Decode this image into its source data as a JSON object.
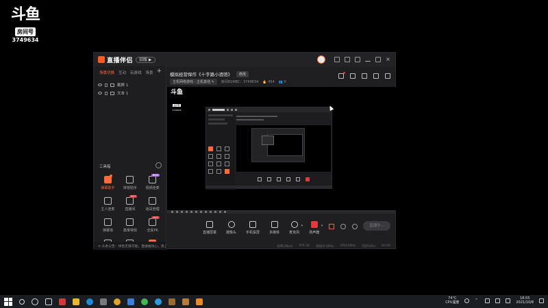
{
  "watermark": {
    "logo": "斗鱼",
    "room_label": "房间号",
    "room_number": "3749634"
  },
  "app": {
    "name": "直播伴侣",
    "version_pill": "旧版 ▶",
    "left": {
      "scene_tabs": [
        "场景切换",
        "互动",
        "玩游戏",
        "场景"
      ],
      "sources": [
        {
          "label": "截屏 1"
        },
        {
          "label": "文本 1"
        }
      ],
      "tools_heading": "工具箱",
      "tools": [
        {
          "label": "弹幕助手",
          "icon": "danmaku-icon",
          "active": true
        },
        {
          "label": "房管助手",
          "icon": "admin-icon",
          "active": false
        },
        {
          "label": "视频连麦",
          "icon": "video-call-icon",
          "active": false,
          "badge": "NEW"
        },
        {
          "label": "主人连麦",
          "icon": "host-call-icon",
          "active": false
        },
        {
          "label": "直播间",
          "icon": "live-room-icon",
          "active": false,
          "badge": "HOT"
        },
        {
          "label": "道具管理",
          "icon": "props-icon",
          "active": false
        },
        {
          "label": "弹幕墙",
          "icon": "danmaku-wall-icon",
          "active": false
        },
        {
          "label": "鼓掌特效",
          "icon": "clap-icon",
          "active": false
        },
        {
          "label": "全民PK",
          "icon": "pk-icon",
          "active": false,
          "badge": "HOT"
        },
        {
          "label": "",
          "icon": "mountain-icon",
          "active": false
        },
        {
          "label": "",
          "icon": "triangle-icon",
          "active": false
        },
        {
          "label": "",
          "icon": "house-icon",
          "active": true
        }
      ],
      "notice": "⊙ 头条公告：绿色无限可能，直播推动心，勇上一层楼"
    },
    "right": {
      "room_title": "模拟经营悍作《十字路小酒馆》",
      "edit_label": "修改",
      "category": "主机网络游戏 - 主机其他 ✎",
      "room_meta": [
        "房间ID/ABC：3749634",
        "🔥 454",
        "👥 0"
      ],
      "bottom_tools": [
        {
          "label": "直播屏幕",
          "icon": "screen-capture-icon"
        },
        {
          "label": "摄像头",
          "icon": "camera-icon"
        },
        {
          "label": "手机投屏",
          "icon": "phone-cast-icon"
        },
        {
          "label": "多媒体",
          "icon": "media-icon"
        },
        {
          "label": "麦克风",
          "icon": "microphone-icon"
        },
        {
          "label": "扬声器",
          "icon": "speaker-icon"
        }
      ],
      "go_live": "直播中...",
      "status_items": [
        "码率(Mb/s)",
        "FPS 30",
        "丢帧(0.00%)",
        "CPU(28%)",
        "内存(0%)",
        "00:00"
      ]
    }
  },
  "taskbar": {
    "weather_temp": "74°C",
    "weather_text": "CPU温度",
    "time": "18:55",
    "date": "2021/10/8"
  }
}
